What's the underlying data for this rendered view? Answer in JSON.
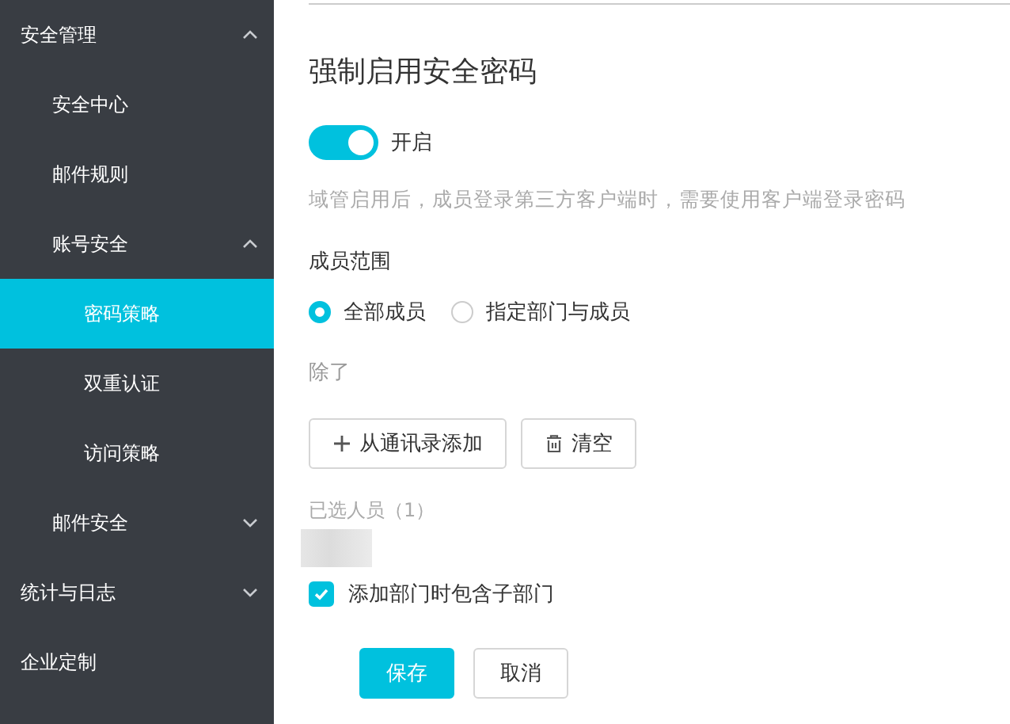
{
  "sidebar": {
    "items": [
      {
        "label": "安全管理",
        "expanded": true,
        "selected": false,
        "children": [
          {
            "label": "安全中心",
            "selected": false
          },
          {
            "label": "邮件规则",
            "selected": false
          },
          {
            "label": "账号安全",
            "expanded": true,
            "selected": false,
            "children": [
              {
                "label": "密码策略",
                "selected": true
              },
              {
                "label": "双重认证",
                "selected": false
              },
              {
                "label": "访问策略",
                "selected": false
              }
            ]
          },
          {
            "label": "邮件安全",
            "expanded": false,
            "selected": false
          }
        ]
      },
      {
        "label": "统计与日志",
        "expanded": false,
        "selected": false
      },
      {
        "label": "企业定制",
        "selected": false
      }
    ]
  },
  "main": {
    "title": "强制启用安全密码",
    "toggle": {
      "on": true,
      "label": "开启"
    },
    "description": "域管启用后，成员登录第三方客户端时，需要使用客户端登录密码",
    "scope_label": "成员范围",
    "scope_options": [
      {
        "label": "全部成员",
        "selected": true
      },
      {
        "label": "指定部门与成员",
        "selected": false
      }
    ],
    "except_label": "除了",
    "add_button": "从通讯录添加",
    "clear_button": "清空",
    "selected_label": "已选人员（1）",
    "include_subdepartments": {
      "label": "添加部门时包含子部门",
      "checked": true
    },
    "save_button": "保存",
    "cancel_button": "取消"
  }
}
